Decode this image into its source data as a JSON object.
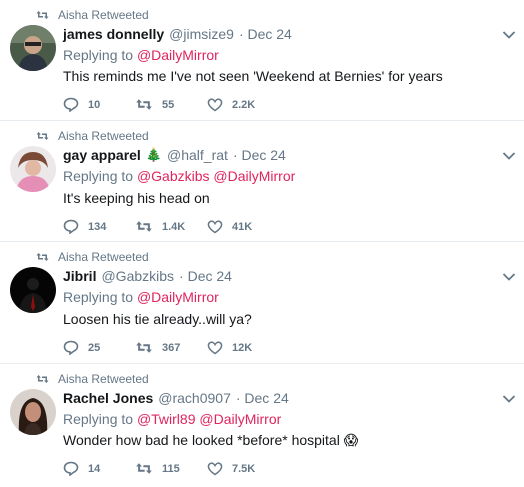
{
  "tweets": [
    {
      "retweeted_by": "Aisha Retweeted",
      "name": "james donnelly",
      "handle": "@jimsize9",
      "date": "· Dec 24",
      "replying_label": "Replying to",
      "replying_to": [
        "@DailyMirror"
      ],
      "text": "This reminds me I've not seen 'Weekend at Bernies' for years",
      "replies": "10",
      "retweets": "55",
      "likes": "2.2K",
      "avatar": "man-with-glasses"
    },
    {
      "retweeted_by": "Aisha Retweeted",
      "name": "gay apparel",
      "name_emoji": "🎄",
      "handle": "@half_rat",
      "date": "· Dec 24",
      "replying_label": "Replying to",
      "replying_to": [
        "@Gabzkibs",
        "@DailyMirror"
      ],
      "text": "It's keeping his head on",
      "replies": "134",
      "retweets": "1.4K",
      "likes": "41K",
      "avatar": "person-pink-sweater"
    },
    {
      "retweeted_by": "Aisha Retweeted",
      "name": "Jibril",
      "handle": "@Gabzkibs",
      "date": "· Dec 24",
      "replying_label": "Replying to",
      "replying_to": [
        "@DailyMirror"
      ],
      "text": "Loosen his tie already..will ya?",
      "replies": "25",
      "retweets": "367",
      "likes": "12K",
      "avatar": "dark-suit-figure"
    },
    {
      "retweeted_by": "Aisha Retweeted",
      "name": "Rachel Jones",
      "handle": "@rach0907",
      "date": "· Dec 24",
      "replying_label": "Replying to",
      "replying_to": [
        "@Twirl89",
        "@DailyMirror"
      ],
      "text": "Wonder how bad he looked *before* hospital",
      "text_emoji": "😱",
      "replies": "14",
      "retweets": "115",
      "likes": "7.5K",
      "avatar": "woman-dark-hair"
    }
  ],
  "colors": {
    "text": "#14171a",
    "muted": "#657786",
    "mention": "#e0245e",
    "divider": "#e6ecf0"
  },
  "icons": [
    "retweet-icon",
    "reply-icon",
    "like-icon",
    "chevron-down-icon"
  ]
}
